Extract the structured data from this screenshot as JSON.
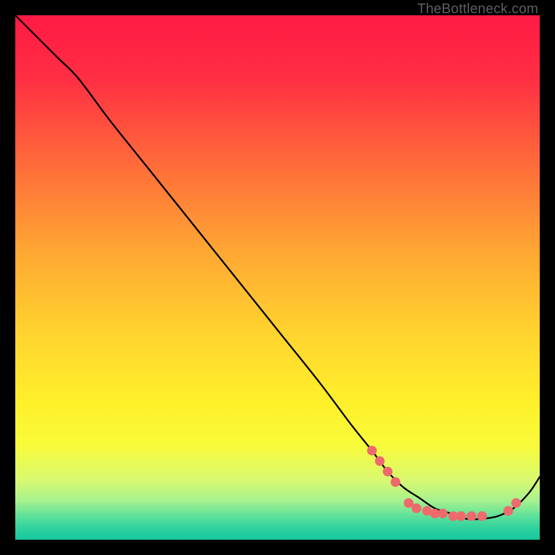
{
  "watermark": "TheBottleneck.com",
  "chart_data": {
    "type": "line",
    "title": "",
    "xlabel": "",
    "ylabel": "",
    "xlim": [
      0,
      100
    ],
    "ylim": [
      0,
      100
    ],
    "grid": false,
    "legend": false,
    "background_gradient": {
      "stops": [
        {
          "pos": 0.0,
          "color": "#ff1a45"
        },
        {
          "pos": 0.12,
          "color": "#ff2e43"
        },
        {
          "pos": 0.28,
          "color": "#ff6a3a"
        },
        {
          "pos": 0.45,
          "color": "#ffa733"
        },
        {
          "pos": 0.6,
          "color": "#ffd22e"
        },
        {
          "pos": 0.74,
          "color": "#fff02a"
        },
        {
          "pos": 0.82,
          "color": "#f8fb3a"
        },
        {
          "pos": 0.885,
          "color": "#d9f96f"
        },
        {
          "pos": 0.925,
          "color": "#a8f28e"
        },
        {
          "pos": 0.955,
          "color": "#5de09a"
        },
        {
          "pos": 0.978,
          "color": "#2fd29f"
        },
        {
          "pos": 1.0,
          "color": "#17c79e"
        }
      ]
    },
    "series": [
      {
        "name": "bottleneck-curve",
        "color": "#000000",
        "x": [
          0,
          4,
          8,
          12,
          18,
          26,
          34,
          42,
          50,
          58,
          64,
          68,
          71,
          74,
          77,
          80,
          83,
          86,
          89,
          92,
          95,
          98,
          100
        ],
        "y": [
          100,
          96,
          92,
          88,
          80,
          70,
          60,
          50,
          40,
          30,
          22,
          17,
          13,
          10,
          8,
          6,
          5,
          4,
          4,
          4.5,
          6,
          9,
          12
        ]
      }
    ],
    "markers": {
      "name": "highlight-points",
      "color": "#ef6a6d",
      "radius": 7,
      "points": [
        {
          "x": 68,
          "y": 17
        },
        {
          "x": 69.5,
          "y": 15
        },
        {
          "x": 71,
          "y": 13
        },
        {
          "x": 72.5,
          "y": 11
        },
        {
          "x": 75,
          "y": 7
        },
        {
          "x": 76.5,
          "y": 6
        },
        {
          "x": 78.5,
          "y": 5.5
        },
        {
          "x": 80,
          "y": 5
        },
        {
          "x": 81.5,
          "y": 5
        },
        {
          "x": 83.5,
          "y": 4.5
        },
        {
          "x": 85,
          "y": 4.5
        },
        {
          "x": 87,
          "y": 4.5
        },
        {
          "x": 89,
          "y": 4.5
        },
        {
          "x": 94,
          "y": 5.5
        },
        {
          "x": 95.5,
          "y": 7
        }
      ]
    }
  }
}
